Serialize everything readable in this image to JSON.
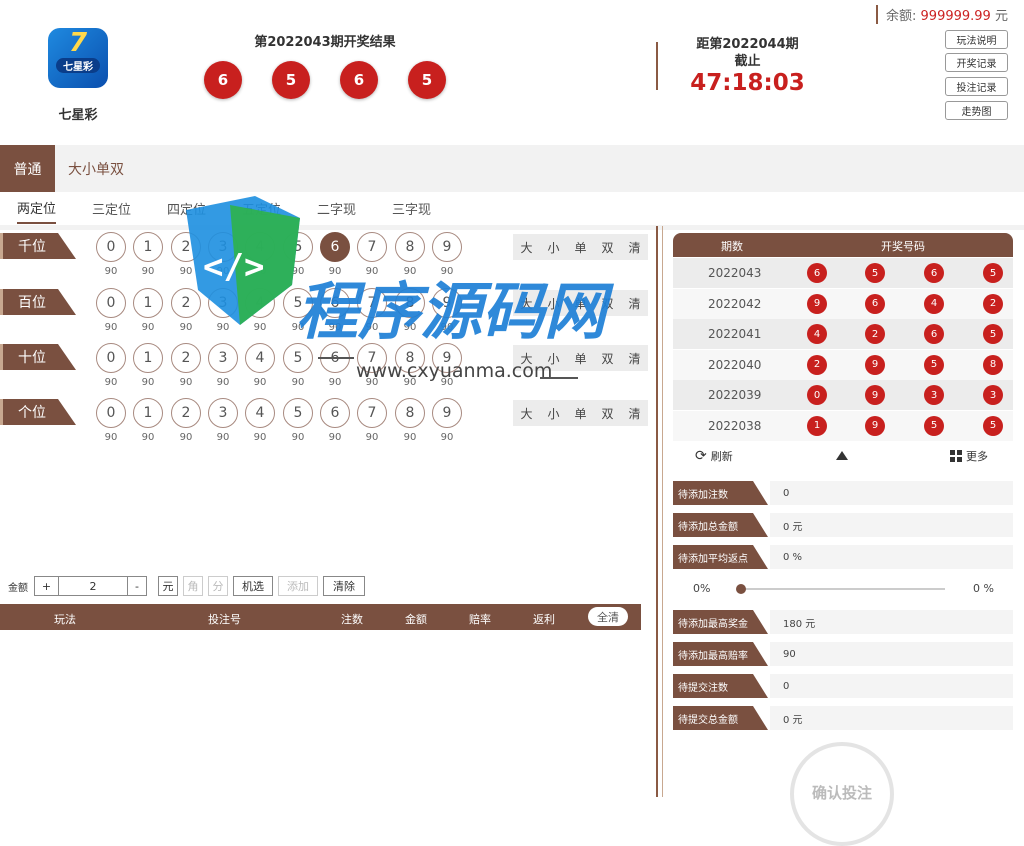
{
  "header": {
    "balance_label": "余额:",
    "balance_value": "999999.99",
    "balance_unit": "元",
    "lottery_name": "七星彩",
    "logo_big": "7",
    "logo_small": "七星彩",
    "result_title": "第2022043期开奖结果",
    "result_balls": [
      "6",
      "5",
      "6",
      "5"
    ],
    "next_title_line1": "距第2022044期",
    "next_title_line2": "截止",
    "countdown": "47:18:03",
    "side_buttons": [
      "玩法说明",
      "开奖记录",
      "投注记录",
      "走势图"
    ]
  },
  "tabs": {
    "main": [
      "普通",
      "大小单双"
    ],
    "sub": [
      "两定位",
      "三定位",
      "四定位",
      "五定位",
      "二字现",
      "三字现"
    ]
  },
  "rows": [
    {
      "label": "千位",
      "selected": 6
    },
    {
      "label": "百位",
      "selected": null
    },
    {
      "label": "十位",
      "selected": null
    },
    {
      "label": "个位",
      "selected": null
    }
  ],
  "numbers": [
    "0",
    "1",
    "2",
    "3",
    "4",
    "5",
    "6",
    "7",
    "8",
    "9"
  ],
  "odds": "90",
  "quick_picks": [
    "大",
    "小",
    "单",
    "双",
    "清"
  ],
  "amount_bar": {
    "label": "金额",
    "plus": "+",
    "value": "2",
    "minus": "-",
    "units": [
      "元",
      "角",
      "分"
    ],
    "random": "机选",
    "add": "添加",
    "clear": "清除"
  },
  "bet_table": {
    "headers": [
      "玩法",
      "投注号",
      "注数",
      "金额",
      "赔率",
      "返利"
    ],
    "clear_all": "全清"
  },
  "history": {
    "headers": [
      "期数",
      "开奖号码"
    ],
    "rows": [
      {
        "issue": "2022043",
        "balls": [
          "6",
          "5",
          "6",
          "5"
        ]
      },
      {
        "issue": "2022042",
        "balls": [
          "9",
          "6",
          "4",
          "2"
        ]
      },
      {
        "issue": "2022041",
        "balls": [
          "4",
          "2",
          "6",
          "5"
        ]
      },
      {
        "issue": "2022040",
        "balls": [
          "2",
          "9",
          "5",
          "8"
        ]
      },
      {
        "issue": "2022039",
        "balls": [
          "0",
          "9",
          "3",
          "3"
        ]
      },
      {
        "issue": "2022038",
        "balls": [
          "1",
          "9",
          "5",
          "5"
        ]
      }
    ],
    "refresh": "刷新",
    "more": "更多"
  },
  "info": [
    {
      "label": "待添加注数",
      "value": "0"
    },
    {
      "label": "待添加总金额",
      "value": "0 元"
    },
    {
      "label": "待添加平均返点",
      "value": "0 %"
    },
    {
      "label": "待添加最高奖金",
      "value": "180 元"
    },
    {
      "label": "待添加最高赔率",
      "value": "90"
    },
    {
      "label": "待提交注数",
      "value": "0"
    },
    {
      "label": "待提交总金额",
      "value": "0 元"
    }
  ],
  "slider": {
    "left": "0%",
    "right": "0 %",
    "level": 0
  },
  "confirm": "确认投注",
  "watermark": {
    "text": "程序源码网",
    "url": "www.cxyuanma.com"
  },
  "colors": {
    "brand": "#7a5040",
    "ball_red": "#c8201e",
    "countdown": "#c8201e"
  }
}
